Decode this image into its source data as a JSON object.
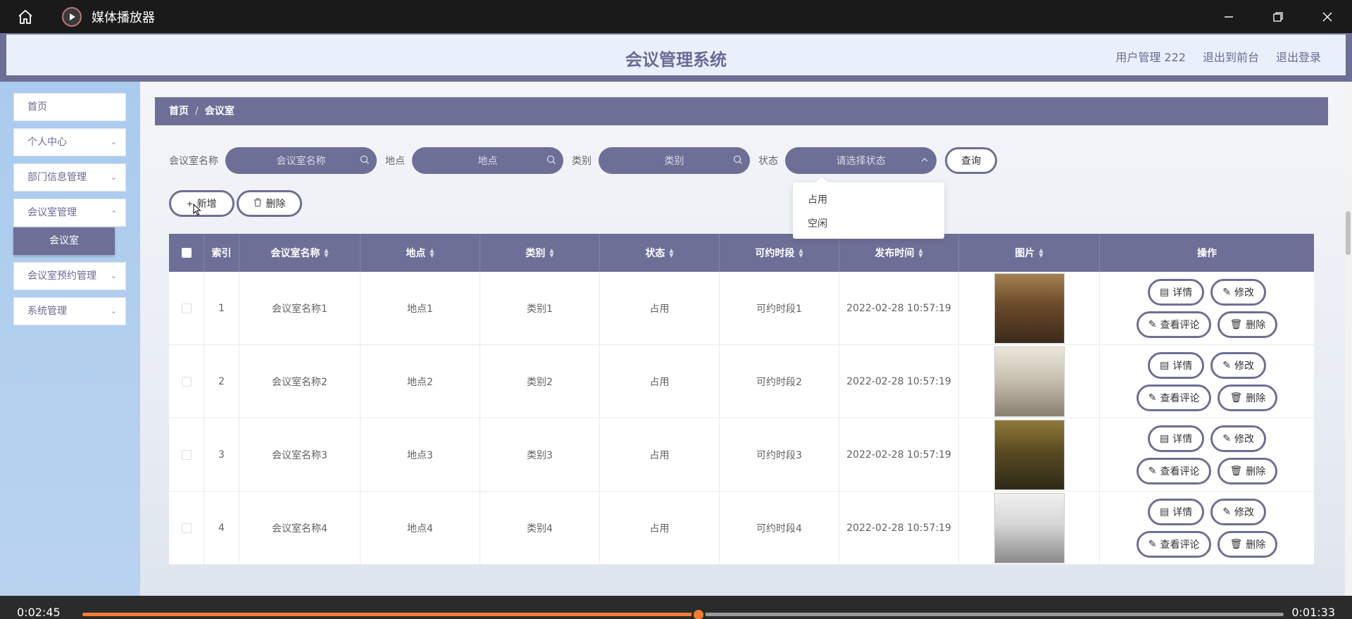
{
  "player": {
    "title": "媒体播放器",
    "current_time": "0:02:45",
    "remaining_time": "0:01:33",
    "progress": 0.513
  },
  "app": {
    "title": "会议管理系统",
    "header_links": [
      "用户管理 222",
      "退出到前台",
      "退出登录"
    ]
  },
  "sidebar": {
    "items": [
      {
        "label": "首页",
        "has_arrow": false
      },
      {
        "label": "个人中心",
        "has_arrow": true
      },
      {
        "label": "部门信息管理",
        "has_arrow": true
      },
      {
        "label": "会议室管理",
        "has_arrow": true
      },
      {
        "label": "会议室预约管理",
        "has_arrow": true
      },
      {
        "label": "系统管理",
        "has_arrow": true
      }
    ],
    "active_sub": "会议室"
  },
  "breadcrumb": {
    "home": "首页",
    "separator": "/",
    "current": "会议室"
  },
  "search": {
    "name_label": "会议室名称",
    "name_placeholder": "会议室名称",
    "location_label": "地点",
    "location_placeholder": "地点",
    "category_label": "类别",
    "category_placeholder": "类别",
    "status_label": "状态",
    "status_placeholder": "请选择状态",
    "query_button": "查询"
  },
  "status_dropdown": {
    "options": [
      "占用",
      "空闲"
    ]
  },
  "actions": {
    "add": "新增",
    "delete": "删除"
  },
  "table": {
    "headers": [
      "索引",
      "会议室名称",
      "地点",
      "类别",
      "状态",
      "可约时段",
      "发布时间",
      "图片",
      "操作"
    ],
    "rows": [
      {
        "index": "1",
        "name": "会议室名称1",
        "location": "地点1",
        "category": "类别1",
        "status": "占用",
        "slot": "可约时段1",
        "time": "2022-02-28 10:57:19"
      },
      {
        "index": "2",
        "name": "会议室名称2",
        "location": "地点2",
        "category": "类别2",
        "status": "占用",
        "slot": "可约时段2",
        "time": "2022-02-28 10:57:19"
      },
      {
        "index": "3",
        "name": "会议室名称3",
        "location": "地点3",
        "category": "类别3",
        "status": "占用",
        "slot": "可约时段3",
        "time": "2022-02-28 10:57:19"
      },
      {
        "index": "4",
        "name": "会议室名称4",
        "location": "地点4",
        "category": "类别4",
        "status": "占用",
        "slot": "可约时段4",
        "time": "2022-02-28 10:57:19"
      }
    ],
    "row_actions": {
      "detail": "详情",
      "edit": "修改",
      "comments": "查看评论",
      "delete": "删除"
    }
  },
  "colors": {
    "accent": "#6e6f96",
    "header_bg": "#e8f1fb",
    "sidebar_bg": "#aacbee",
    "progress": "#f07e36"
  }
}
